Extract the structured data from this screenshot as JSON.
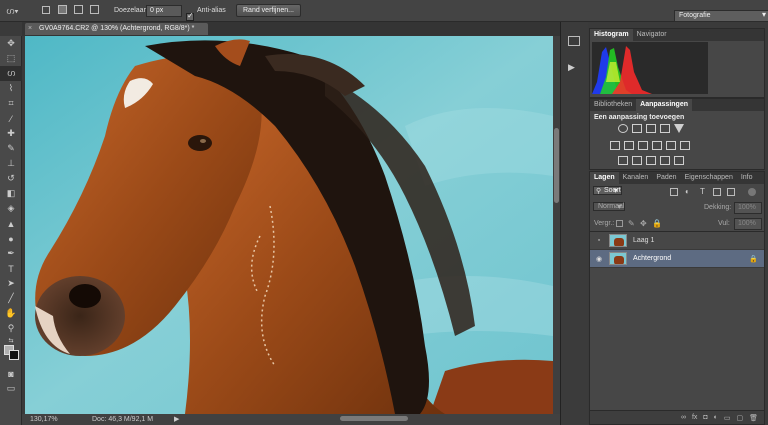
{
  "options_bar": {
    "feather_label": "Doezelaar:",
    "feather_value": "0 px",
    "antialias_label": "Anti-alias",
    "refine_button": "Rand verfijnen...",
    "workspace": "Fotografie"
  },
  "document": {
    "tab_title": "GV0A9764.CR2 @ 130% (Achtergrond, RG8/8*) *",
    "zoom": "130,17%",
    "doc_info": "Doc: 46,3 M/92,1 M"
  },
  "histogram_panel": {
    "tabs": [
      "Histogram",
      "Navigator"
    ]
  },
  "adjustments_panel": {
    "tabs": [
      "Bibliotheken",
      "Aanpassingen"
    ],
    "heading": "Een aanpassing toevoegen"
  },
  "layers_panel": {
    "tabs": [
      "Lagen",
      "Kanalen",
      "Paden",
      "Eigenschappen",
      "Info"
    ],
    "filter_kind": "Soort",
    "blend_mode": "Normaal",
    "opacity_label": "Dekking:",
    "opacity_value": "100%",
    "lock_label": "Vergr.:",
    "fill_label": "Vul:",
    "fill_value": "100%",
    "layers": [
      {
        "name": "Laag 1",
        "visible": false,
        "selected": false
      },
      {
        "name": "Achtergrond",
        "visible": true,
        "selected": true
      }
    ],
    "bottom_icons": [
      "link-icon",
      "fx-icon",
      "mask-icon",
      "adjustment-icon",
      "folder-icon",
      "new-layer-icon",
      "trash-icon"
    ]
  },
  "colors": {
    "selected_layer": "#5d6b82",
    "panel_bg": "#474747",
    "foreground_swatch": "#b0b0b0",
    "background_swatch": "#111111"
  }
}
